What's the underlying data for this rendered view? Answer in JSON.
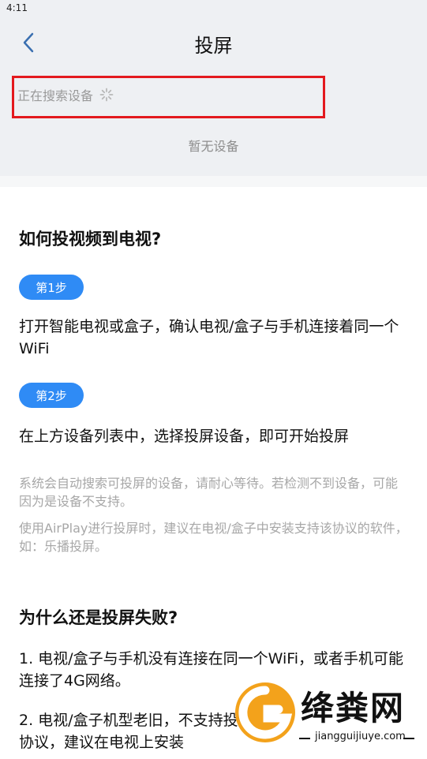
{
  "status_bar": {
    "time": "4:11"
  },
  "nav": {
    "title": "投屏",
    "back_icon": "chevron-left-icon"
  },
  "device_panel": {
    "searching_text": "正在搜索设备",
    "no_device_text": "暂无设备"
  },
  "guide": {
    "heading1": "如何投视频到电视?",
    "step1_label": "第1步",
    "step1_text": "打开智能电视或盒子，确认电视/盒子与手机连接着同一个WiFi",
    "step2_label": "第2步",
    "step2_text": "在上方设备列表中，选择投屏设备，即可开始投屏",
    "note1": "系统会自动搜索可投屏的设备，请耐心等待。若检测不到设备，可能因为是设备不支持。",
    "note2": "使用AirPlay进行投屏时，建议在电视/盒子中安装支持该协议的软件，如：乐播投屏。",
    "heading2": "为什么还是投屏失败?",
    "reason1": "1. 电视/盒子与手机没有连接在同一个WiFi，或者手机可能连接了4G网络。",
    "reason2": "2. 电视/盒子机型老旧，不支持投屏协议，建议在电视上安装"
  },
  "watermark": {
    "brand": "绛粪网",
    "url": "jiangguijiuye.com"
  },
  "colors": {
    "accent": "#2f8bf5",
    "highlight": "#e3191e",
    "panel_bg": "#eef0f3"
  }
}
